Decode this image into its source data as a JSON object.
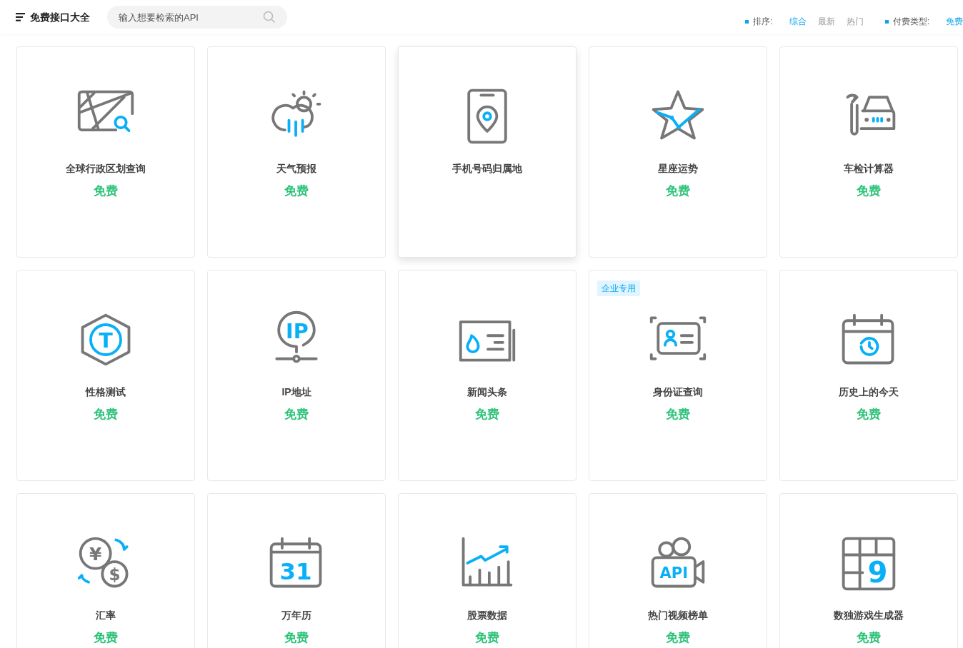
{
  "header": {
    "title": "免费接口大全",
    "search": {
      "placeholder": "输入想要检索的API"
    }
  },
  "filters": [
    {
      "label": "排序:",
      "options": [
        {
          "label": "综合",
          "selected": true
        },
        {
          "label": "最新",
          "selected": false
        },
        {
          "label": "热门",
          "selected": false
        }
      ]
    },
    {
      "label": "付费类型:",
      "options": [
        {
          "label": "免费",
          "selected": true
        }
      ]
    }
  ],
  "cards": [
    {
      "title": "全球行政区划查询",
      "price": "免费",
      "hovered": false
    },
    {
      "title": "天气预报",
      "price": "免费",
      "hovered": false
    },
    {
      "title": "手机号码归属地",
      "hovered": true
    },
    {
      "title": "星座运势",
      "price": "免费",
      "hovered": false
    },
    {
      "title": "车检计算器",
      "price": "免费",
      "hovered": false
    },
    {
      "title": "性格测试",
      "price": "免费",
      "hovered": false,
      "icon_text": "T"
    },
    {
      "title": "IP地址",
      "price": "免费",
      "hovered": false,
      "icon_text": "IP"
    },
    {
      "title": "新闻头条",
      "price": "免费",
      "hovered": false
    },
    {
      "title": "身份证查询",
      "price": "免费",
      "hovered": false,
      "badge": "企业专用"
    },
    {
      "title": "历史上的今天",
      "price": "免费",
      "hovered": false
    },
    {
      "title": "汇率",
      "price": "免费",
      "hovered": false,
      "icon_text": "¥ $"
    },
    {
      "title": "万年历",
      "price": "免费",
      "hovered": false,
      "icon_text": "31"
    },
    {
      "title": "股票数据",
      "price": "免费",
      "hovered": false
    },
    {
      "title": "热门视频榜单",
      "price": "免费",
      "hovered": false,
      "icon_text": "API"
    },
    {
      "title": "数独游戏生成器",
      "price": "免费",
      "hovered": false,
      "icon_text": "9"
    }
  ]
}
